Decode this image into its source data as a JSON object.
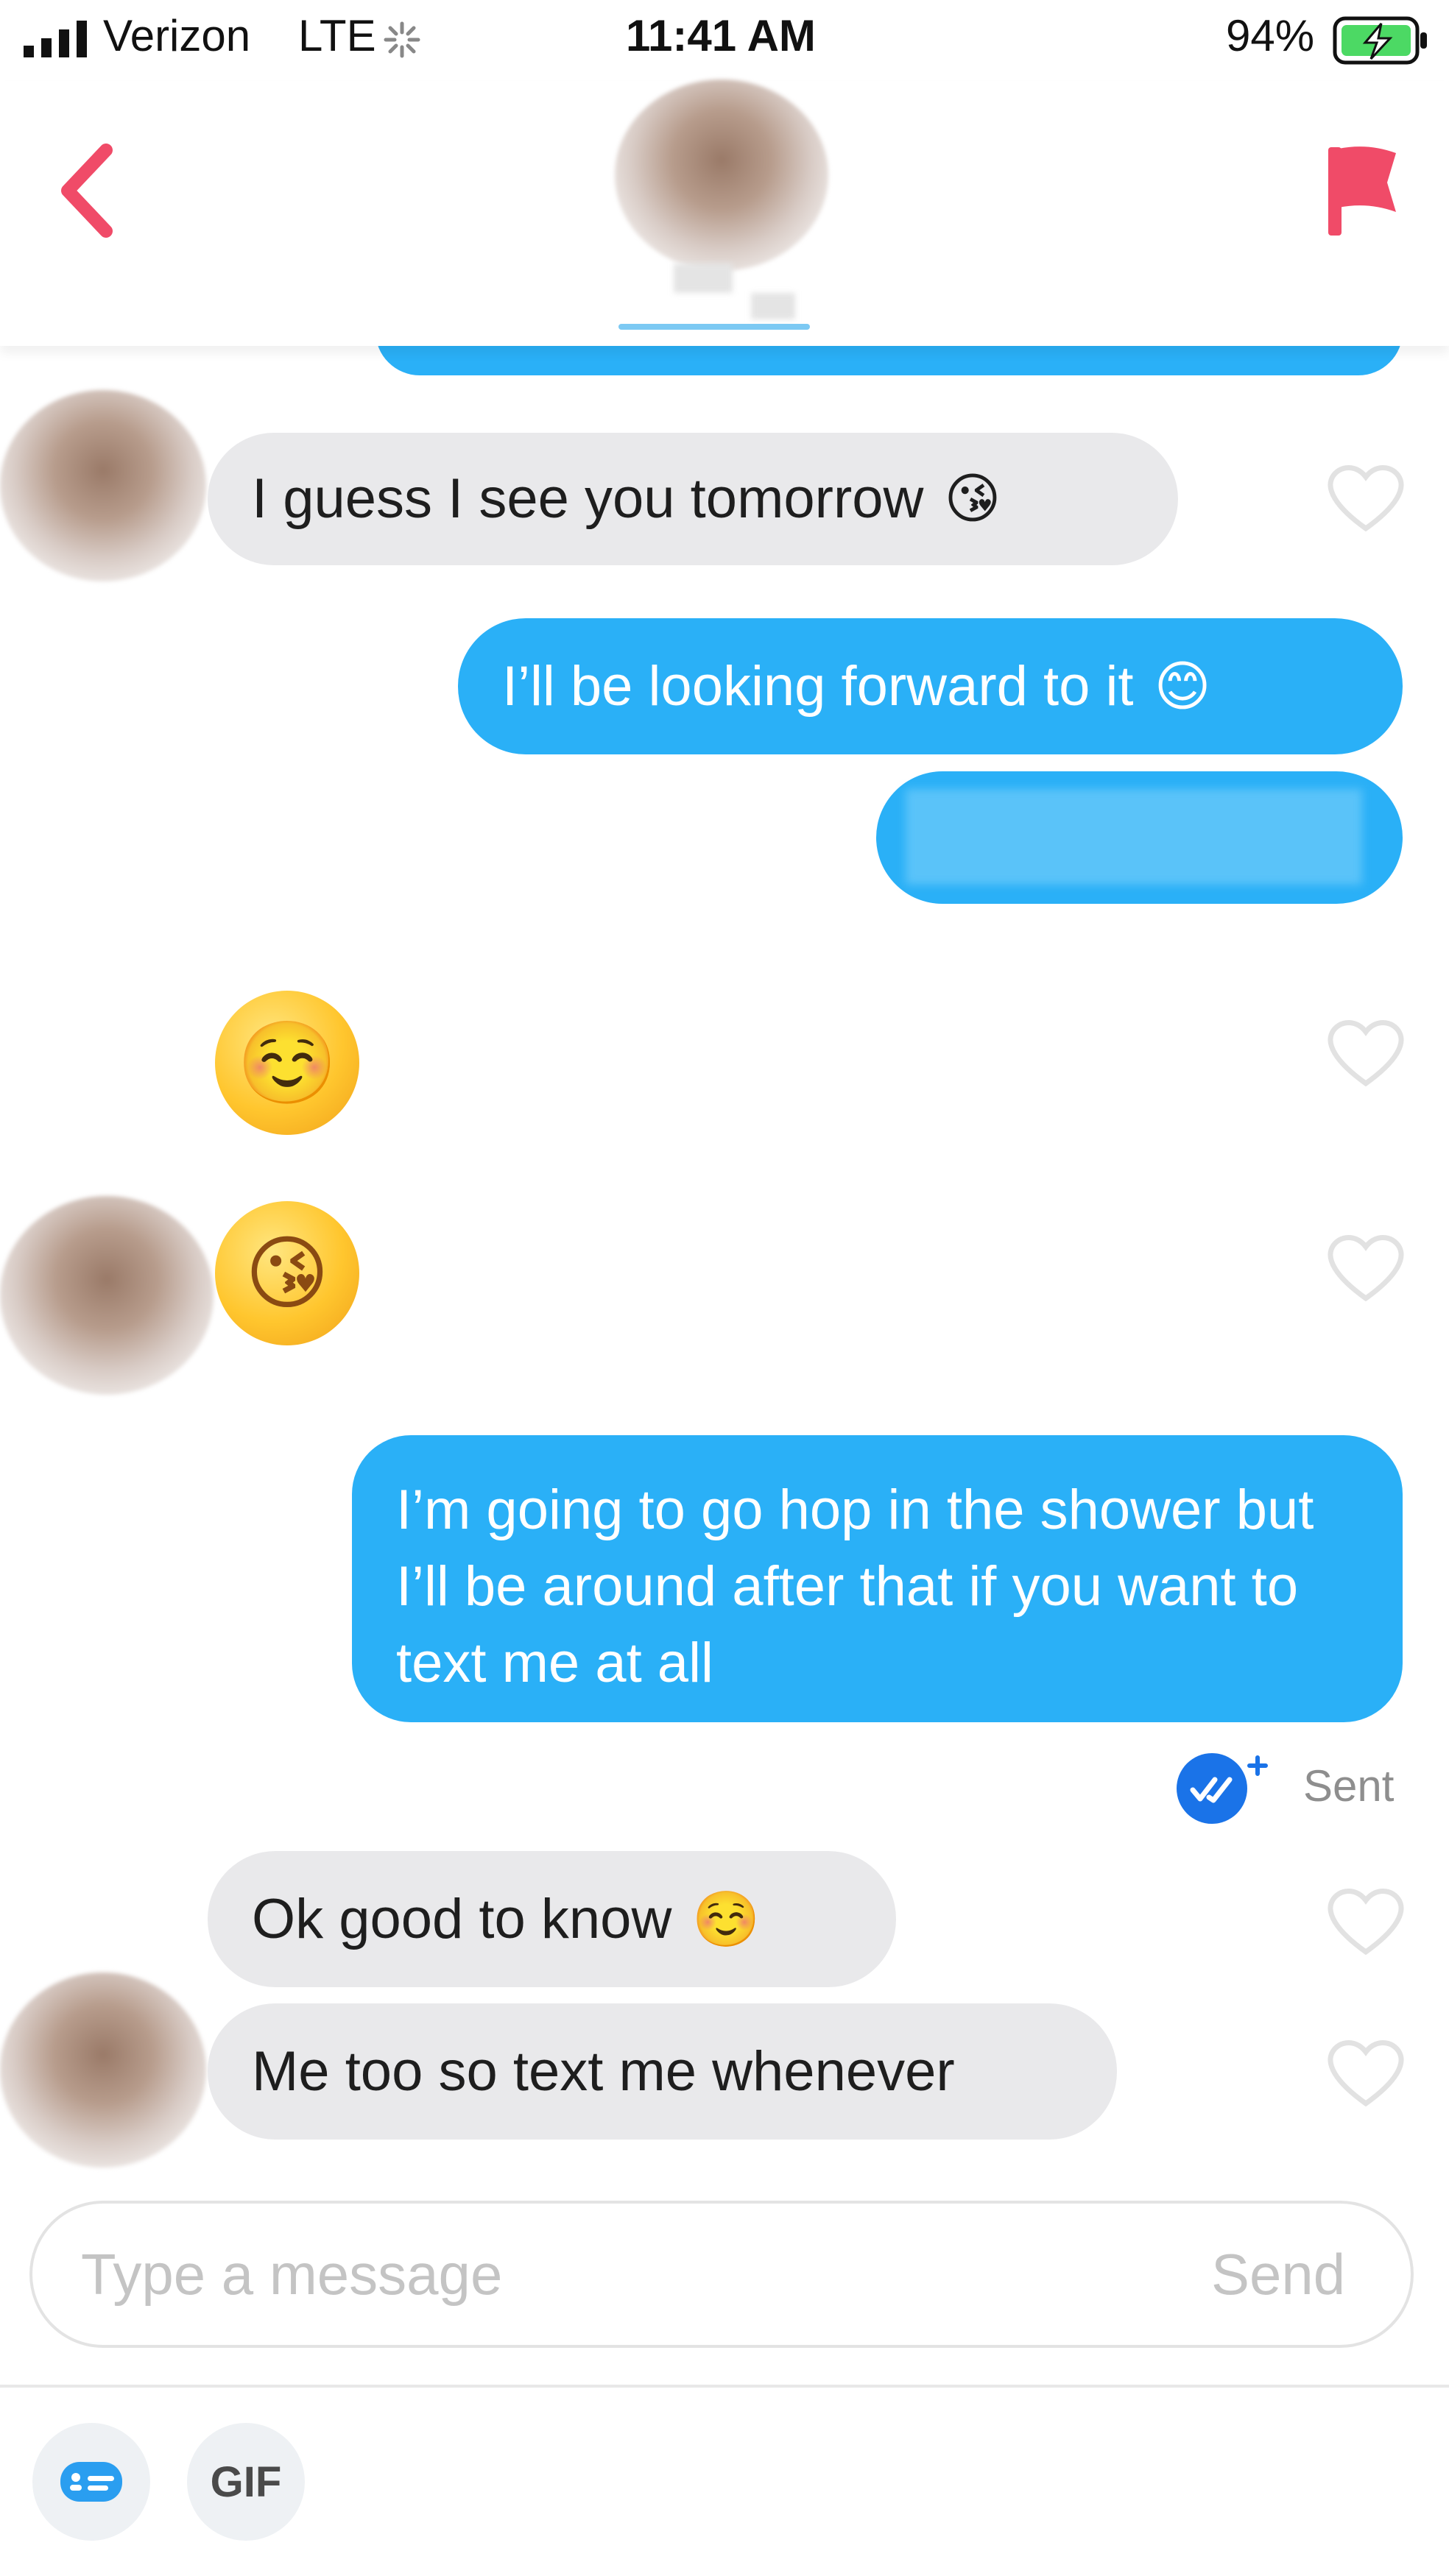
{
  "status_bar": {
    "carrier": "Verizon",
    "network": "LTE",
    "time": "11:41 AM",
    "battery": "94%"
  },
  "header": {
    "back_icon": "chevron-left-icon",
    "flag_icon": "flag-icon",
    "accent_color": "#f04b68"
  },
  "messages": [
    {
      "side": "in",
      "text": "I guess I see you tomorrow",
      "emoji": "😘"
    },
    {
      "side": "out",
      "text": "I’ll be looking forward to it",
      "emoji": "😊"
    },
    {
      "side": "out",
      "text": ""
    },
    {
      "side": "in",
      "emoji_only": "☺️"
    },
    {
      "side": "in",
      "emoji_only": "😘"
    },
    {
      "side": "out",
      "text": "I’m going to go hop in the shower but I’ll be around after that if you want to text me at all"
    },
    {
      "side": "in",
      "text": "Ok good to know",
      "emoji": "☺️"
    },
    {
      "side": "in",
      "text": "Me too so text me whenever"
    }
  ],
  "receipt": {
    "label": "Sent",
    "icon": "double-check-icon"
  },
  "composer": {
    "placeholder": "Type a message",
    "send_label": "Send"
  },
  "toolbar": {
    "sticker_icon": "card-icon",
    "gif_label": "GIF"
  },
  "colors": {
    "outgoing_bubble": "#2ab0f7",
    "incoming_bubble": "#e9e9eb",
    "receipt_blue": "#1a73e8"
  }
}
